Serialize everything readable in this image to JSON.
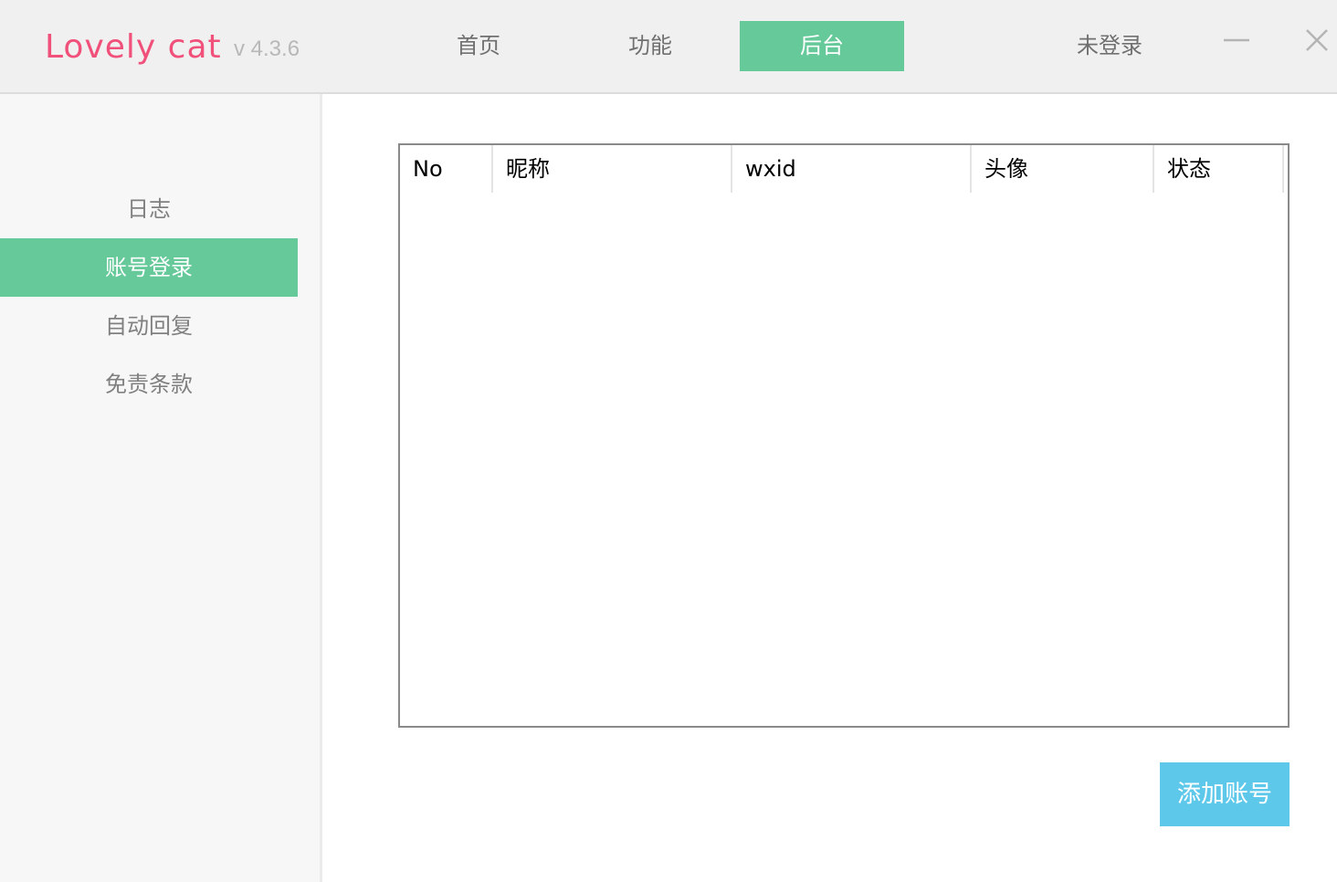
{
  "app": {
    "name": "Lovely cat",
    "version": "v 4.3.6",
    "brand_color": "#f0507a"
  },
  "nav": {
    "tabs": [
      {
        "label": "首页",
        "active": false
      },
      {
        "label": "功能",
        "active": false
      },
      {
        "label": "后台",
        "active": true
      }
    ],
    "accent_color": "#66c999"
  },
  "header": {
    "login_status": "未登录",
    "window_controls": [
      "minimize-icon",
      "close-icon"
    ]
  },
  "sidebar": {
    "items": [
      {
        "label": "日志",
        "active": false
      },
      {
        "label": "账号登录",
        "active": true
      },
      {
        "label": "自动回复",
        "active": false
      },
      {
        "label": "免责条款",
        "active": false
      }
    ]
  },
  "table": {
    "columns": [
      "No",
      "昵称",
      "wxid",
      "头像",
      "状态"
    ],
    "rows": []
  },
  "actions": {
    "add_account_label": "添加账号",
    "add_account_color": "#5ec8ea"
  }
}
